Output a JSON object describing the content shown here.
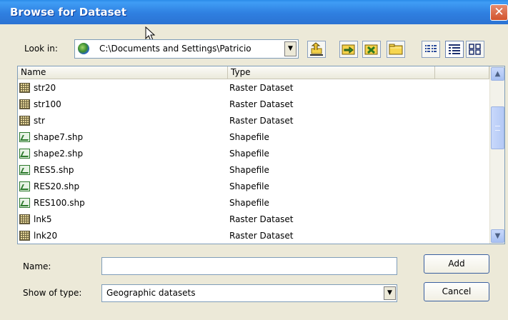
{
  "window": {
    "title": "Browse for Dataset",
    "close_glyph": "✕"
  },
  "toolbar": {
    "look_in_label": "Look in:",
    "look_in_value": "C:\\Documents and Settings\\Patricio",
    "look_in_icon": "globe-icon",
    "buttons": [
      {
        "name": "up-one-level-button",
        "icon": "folder-up-icon"
      },
      {
        "name": "connect-folder-button",
        "icon": "connect-folder-icon"
      },
      {
        "name": "disconnect-folder-button",
        "icon": "disconnect-folder-icon"
      },
      {
        "name": "new-folder-button",
        "icon": "new-folder-icon"
      },
      {
        "name": "list-view-button",
        "icon": "list-view-icon"
      },
      {
        "name": "details-view-button",
        "icon": "details-view-icon"
      },
      {
        "name": "thumbnails-view-button",
        "icon": "thumbnails-view-icon"
      }
    ]
  },
  "list": {
    "columns": [
      "Name",
      "Type"
    ],
    "rows": [
      {
        "name": "str20",
        "type": "Raster Dataset",
        "icon": "raster"
      },
      {
        "name": "str100",
        "type": "Raster Dataset",
        "icon": "raster"
      },
      {
        "name": "str",
        "type": "Raster Dataset",
        "icon": "raster"
      },
      {
        "name": "shape7.shp",
        "type": "Shapefile",
        "icon": "shape"
      },
      {
        "name": "shape2.shp",
        "type": "Shapefile",
        "icon": "shape"
      },
      {
        "name": "RES5.shp",
        "type": "Shapefile",
        "icon": "shape"
      },
      {
        "name": "RES20.shp",
        "type": "Shapefile",
        "icon": "shape"
      },
      {
        "name": "RES100.shp",
        "type": "Shapefile",
        "icon": "shape"
      },
      {
        "name": "lnk5",
        "type": "Raster Dataset",
        "icon": "raster"
      },
      {
        "name": "lnk20",
        "type": "Raster Dataset",
        "icon": "raster"
      }
    ]
  },
  "form": {
    "name_label": "Name:",
    "name_value": "",
    "show_type_label": "Show of type:",
    "show_type_value": "Geographic datasets",
    "add_label": "Add",
    "cancel_label": "Cancel"
  },
  "colors": {
    "titlebar": "#2f7fe0",
    "dialog_bg": "#ece9d8",
    "close": "#d2532d"
  }
}
